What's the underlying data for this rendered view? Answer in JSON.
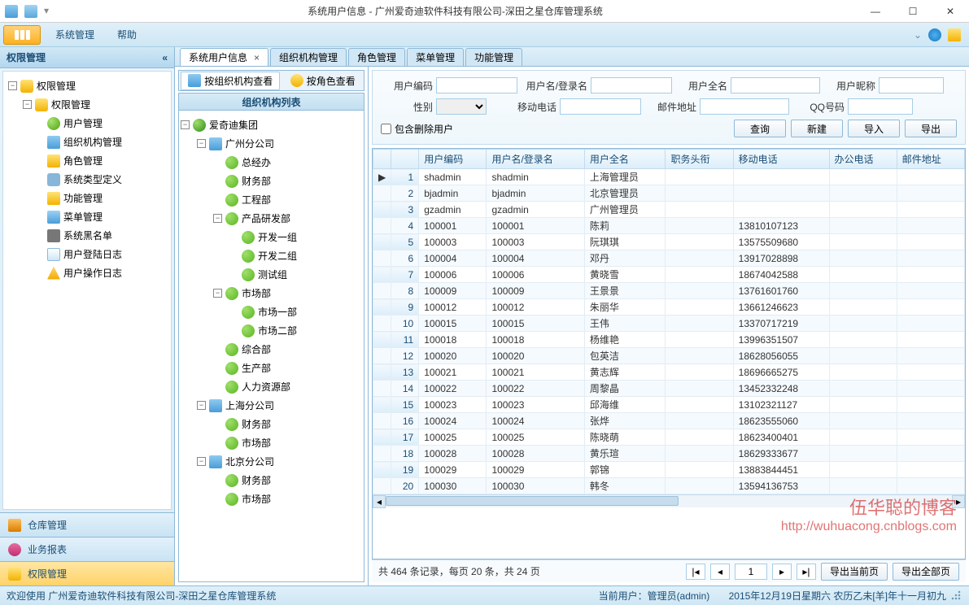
{
  "window": {
    "title": "系统用户信息 - 广州爱奇迪软件科技有限公司-深田之星仓库管理系统"
  },
  "ribbon": {
    "items": [
      "系统管理",
      "帮助"
    ]
  },
  "leftnav": {
    "header": "权限管理",
    "tree_root": "权限管理",
    "tree_sub": "权限管理",
    "tree_items": [
      {
        "label": "用户管理",
        "icon": "useric"
      },
      {
        "label": "组织机构管理",
        "icon": "orgchart"
      },
      {
        "label": "角色管理",
        "icon": "keyic"
      },
      {
        "label": "系统类型定义",
        "icon": "gearic"
      },
      {
        "label": "功能管理",
        "icon": "keyic"
      },
      {
        "label": "菜单管理",
        "icon": "menuic"
      },
      {
        "label": "系统黑名单",
        "icon": "blackic"
      },
      {
        "label": "用户登陆日志",
        "icon": "logic"
      },
      {
        "label": "用户操作日志",
        "icon": "warnic"
      }
    ],
    "bottom": [
      {
        "label": "仓库管理",
        "icon": "houseic"
      },
      {
        "label": "业务报表",
        "icon": "chartic"
      },
      {
        "label": "权限管理",
        "icon": "shieldic",
        "active": true
      }
    ]
  },
  "tabs": [
    {
      "label": "系统用户信息",
      "closable": true,
      "active": true
    },
    {
      "label": "组织机构管理"
    },
    {
      "label": "角色管理"
    },
    {
      "label": "菜单管理"
    },
    {
      "label": "功能管理"
    }
  ],
  "viewtabs": {
    "org": "按组织机构查看",
    "role": "按角色查看"
  },
  "org": {
    "header": "组织机构列表",
    "root": "爱奇迪集团",
    "branches": [
      {
        "label": "广州分公司",
        "children": [
          {
            "label": "总经办"
          },
          {
            "label": "财务部"
          },
          {
            "label": "工程部"
          },
          {
            "label": "产品研发部",
            "children": [
              {
                "label": "开发一组"
              },
              {
                "label": "开发二组"
              },
              {
                "label": "测试组"
              }
            ]
          },
          {
            "label": "市场部",
            "children": [
              {
                "label": "市场一部"
              },
              {
                "label": "市场二部"
              }
            ]
          },
          {
            "label": "综合部"
          },
          {
            "label": "生产部"
          },
          {
            "label": "人力资源部"
          }
        ]
      },
      {
        "label": "上海分公司",
        "children": [
          {
            "label": "财务部"
          },
          {
            "label": "市场部"
          }
        ]
      },
      {
        "label": "北京分公司",
        "children": [
          {
            "label": "财务部"
          },
          {
            "label": "市场部"
          }
        ]
      }
    ]
  },
  "filters": {
    "labels": {
      "user_code": "用户编码",
      "login": "用户名/登录名",
      "fullname": "用户全名",
      "nick": "用户昵称",
      "gender": "性别",
      "mobile": "移动电话",
      "email": "邮件地址",
      "qq": "QQ号码",
      "include_deleted": "包含删除用户"
    },
    "buttons": {
      "query": "查询",
      "new": "新建",
      "import": "导入",
      "export": "导出"
    }
  },
  "grid": {
    "columns": [
      "",
      "",
      "用户编码",
      "用户名/登录名",
      "用户全名",
      "职务头衔",
      "移动电话",
      "办公电话",
      "邮件地址"
    ],
    "rows": [
      {
        "n": 1,
        "ind": "▶",
        "code": "shadmin",
        "login": "shadmin",
        "name": "上海管理员",
        "title": "",
        "mobile": "",
        "office": "",
        "email": ""
      },
      {
        "n": 2,
        "code": "bjadmin",
        "login": "bjadmin",
        "name": "北京管理员",
        "title": "",
        "mobile": "",
        "office": "",
        "email": ""
      },
      {
        "n": 3,
        "code": "gzadmin",
        "login": "gzadmin",
        "name": "广州管理员",
        "title": "",
        "mobile": "",
        "office": "",
        "email": ""
      },
      {
        "n": 4,
        "code": "100001",
        "login": "100001",
        "name": "陈莉",
        "title": "",
        "mobile": "13810107123",
        "office": "",
        "email": ""
      },
      {
        "n": 5,
        "code": "100003",
        "login": "100003",
        "name": "阮琪琪",
        "title": "",
        "mobile": "13575509680",
        "office": "",
        "email": ""
      },
      {
        "n": 6,
        "code": "100004",
        "login": "100004",
        "name": "邓丹",
        "title": "",
        "mobile": "13917028898",
        "office": "",
        "email": ""
      },
      {
        "n": 7,
        "code": "100006",
        "login": "100006",
        "name": "黄晓雪",
        "title": "",
        "mobile": "18674042588",
        "office": "",
        "email": ""
      },
      {
        "n": 8,
        "code": "100009",
        "login": "100009",
        "name": "王景景",
        "title": "",
        "mobile": "13761601760",
        "office": "",
        "email": ""
      },
      {
        "n": 9,
        "code": "100012",
        "login": "100012",
        "name": "朱丽华",
        "title": "",
        "mobile": "13661246623",
        "office": "",
        "email": ""
      },
      {
        "n": 10,
        "code": "100015",
        "login": "100015",
        "name": "王伟",
        "title": "",
        "mobile": "13370717219",
        "office": "",
        "email": ""
      },
      {
        "n": 11,
        "code": "100018",
        "login": "100018",
        "name": "杨维艳",
        "title": "",
        "mobile": "13996351507",
        "office": "",
        "email": ""
      },
      {
        "n": 12,
        "code": "100020",
        "login": "100020",
        "name": "包英洁",
        "title": "",
        "mobile": "18628056055",
        "office": "",
        "email": ""
      },
      {
        "n": 13,
        "code": "100021",
        "login": "100021",
        "name": "黄志辉",
        "title": "",
        "mobile": "18696665275",
        "office": "",
        "email": ""
      },
      {
        "n": 14,
        "code": "100022",
        "login": "100022",
        "name": "周黎晶",
        "title": "",
        "mobile": "13452332248",
        "office": "",
        "email": ""
      },
      {
        "n": 15,
        "code": "100023",
        "login": "100023",
        "name": "邱海维",
        "title": "",
        "mobile": "13102321127",
        "office": "",
        "email": ""
      },
      {
        "n": 16,
        "code": "100024",
        "login": "100024",
        "name": "张烨",
        "title": "",
        "mobile": "18623555060",
        "office": "",
        "email": ""
      },
      {
        "n": 17,
        "code": "100025",
        "login": "100025",
        "name": "陈晓萌",
        "title": "",
        "mobile": "18623400401",
        "office": "",
        "email": ""
      },
      {
        "n": 18,
        "code": "100028",
        "login": "100028",
        "name": "黄乐瑄",
        "title": "",
        "mobile": "18629333677",
        "office": "",
        "email": ""
      },
      {
        "n": 19,
        "code": "100029",
        "login": "100029",
        "name": "郭锦",
        "title": "",
        "mobile": "13883844451",
        "office": "",
        "email": ""
      },
      {
        "n": 20,
        "code": "100030",
        "login": "100030",
        "name": "韩冬",
        "title": "",
        "mobile": "13594136753",
        "office": "",
        "email": ""
      }
    ]
  },
  "pager": {
    "info": "共 464 条记录，每页 20 条，共 24 页",
    "page": "1",
    "export_page": "导出当前页",
    "export_all": "导出全部页"
  },
  "watermark": {
    "line1": "伍华聪的博客",
    "line2": "http://wuhuacong.cnblogs.com"
  },
  "status": {
    "left": "欢迎使用 广州爱奇迪软件科技有限公司-深田之星仓库管理系统",
    "user": "当前用户：管理员(admin)",
    "date": "2015年12月19日星期六 农历乙未[羊]年十一月初九"
  }
}
